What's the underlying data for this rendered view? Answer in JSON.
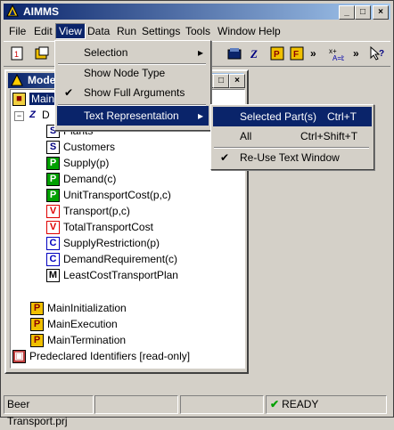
{
  "app": {
    "title": "AIMMS"
  },
  "menubar": [
    "File",
    "Edit",
    "View",
    "Data",
    "Run",
    "Settings",
    "Tools",
    "Window",
    "Help"
  ],
  "child_window": {
    "title": "Mode"
  },
  "tree": {
    "main_node": "Main",
    "declaration_prefix": "D",
    "items": [
      {
        "icon": "S",
        "label": "Plants"
      },
      {
        "icon": "S",
        "label": "Customers"
      },
      {
        "icon": "P",
        "label": "Supply(p)"
      },
      {
        "icon": "P",
        "label": "Demand(c)"
      },
      {
        "icon": "P",
        "label": "UnitTransportCost(p,c)"
      },
      {
        "icon": "V",
        "label": "Transport(p,c)"
      },
      {
        "icon": "V",
        "label": "TotalTransportCost"
      },
      {
        "icon": "C",
        "label": "SupplyRestriction(p)"
      },
      {
        "icon": "C",
        "label": "DemandRequirement(c)"
      },
      {
        "icon": "M",
        "label": "LeastCostTransportPlan"
      }
    ],
    "procedures": [
      "MainInitialization",
      "MainExecution",
      "MainTermination"
    ],
    "predeclared": "Predeclared Identifiers [read-only]"
  },
  "view_menu": {
    "selection": "Selection",
    "show_node_type": "Show Node Type",
    "show_full_arguments": "Show Full Arguments",
    "text_representation": "Text Representation"
  },
  "text_rep_submenu": {
    "selected_parts": "Selected Part(s)",
    "selected_parts_shortcut": "Ctrl+T",
    "all": "All",
    "all_shortcut": "Ctrl+Shift+T",
    "reuse_text_window": "Re-Use Text Window"
  },
  "status": {
    "project": "Beer Transport.prj",
    "state": "READY"
  },
  "colors": {
    "highlight": "#0a246a",
    "title_gradient_end": "#a6caf0",
    "face": "#d4d0c8"
  }
}
